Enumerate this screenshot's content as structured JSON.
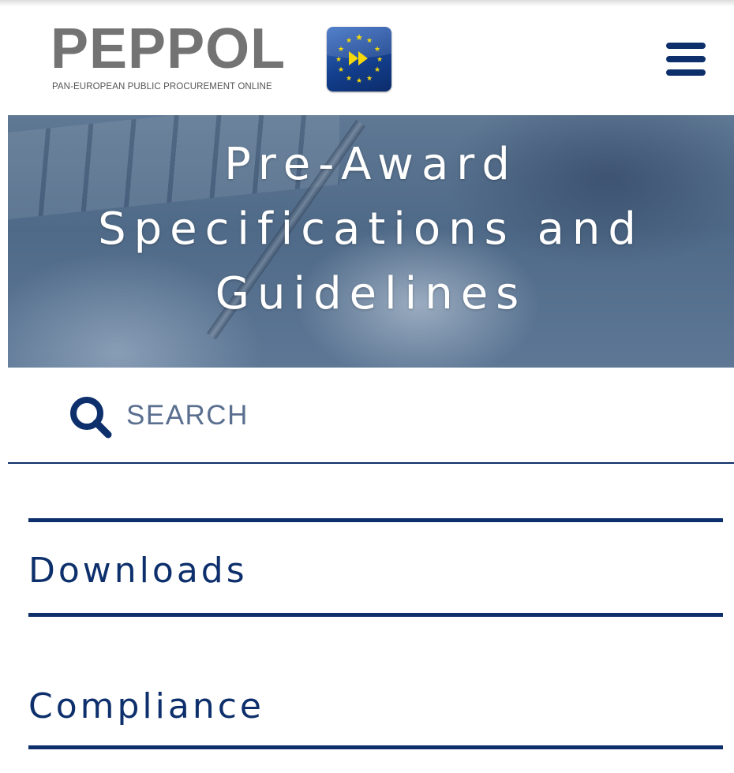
{
  "header": {
    "logo": {
      "wordmark": "PEPPOL",
      "tagline": "PAN-EUROPEAN PUBLIC PROCUREMENT ONLINE",
      "flag_icon": "eu-stars-forward-icon"
    },
    "menu_icon": "hamburger-menu-icon"
  },
  "hero": {
    "title_lines": [
      "Pre-Award",
      "Specifications and",
      "Guidelines"
    ]
  },
  "search": {
    "icon": "search-icon",
    "placeholder": "SEARCH",
    "value": ""
  },
  "nav": {
    "items": [
      {
        "label": "Downloads"
      },
      {
        "label": "Compliance"
      }
    ]
  },
  "colors": {
    "primary_navy": "#0d2f6b",
    "logo_grey": "#737373",
    "flag_blue": "#14408f",
    "flag_yellow": "#f5d90a"
  }
}
